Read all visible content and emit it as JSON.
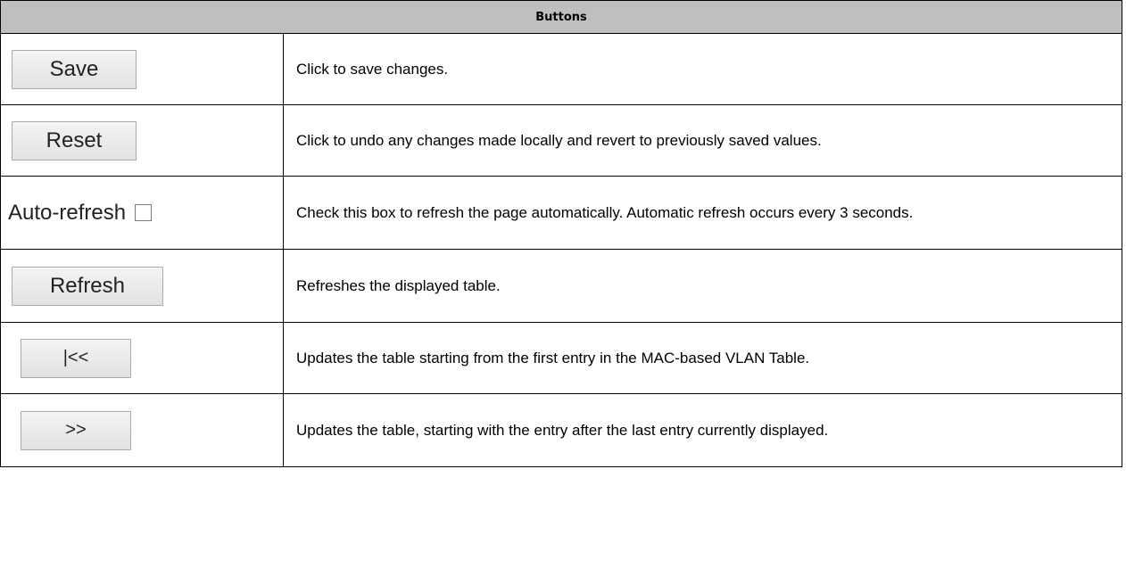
{
  "table": {
    "header": "Buttons",
    "rows": [
      {
        "control": "Save",
        "description": "Click to save changes."
      },
      {
        "control": "Reset",
        "description": "Click to undo any changes made locally and revert to previously saved values."
      },
      {
        "control": "Auto-refresh",
        "checkbox_checked": false,
        "description": "Check this box to refresh the page automatically. Automatic refresh occurs every 3 seconds."
      },
      {
        "control": "Refresh",
        "description": "Refreshes the displayed table."
      },
      {
        "control": "|<<",
        "description": "Updates the table starting from the first entry in the MAC-based VLAN Table."
      },
      {
        "control": ">>",
        "description": "Updates the table, starting with the entry after the last entry currently displayed."
      }
    ]
  },
  "colors": {
    "header_bg": "#bfbfbf",
    "border": "#000000",
    "button_bg": "#e8e8e8"
  }
}
